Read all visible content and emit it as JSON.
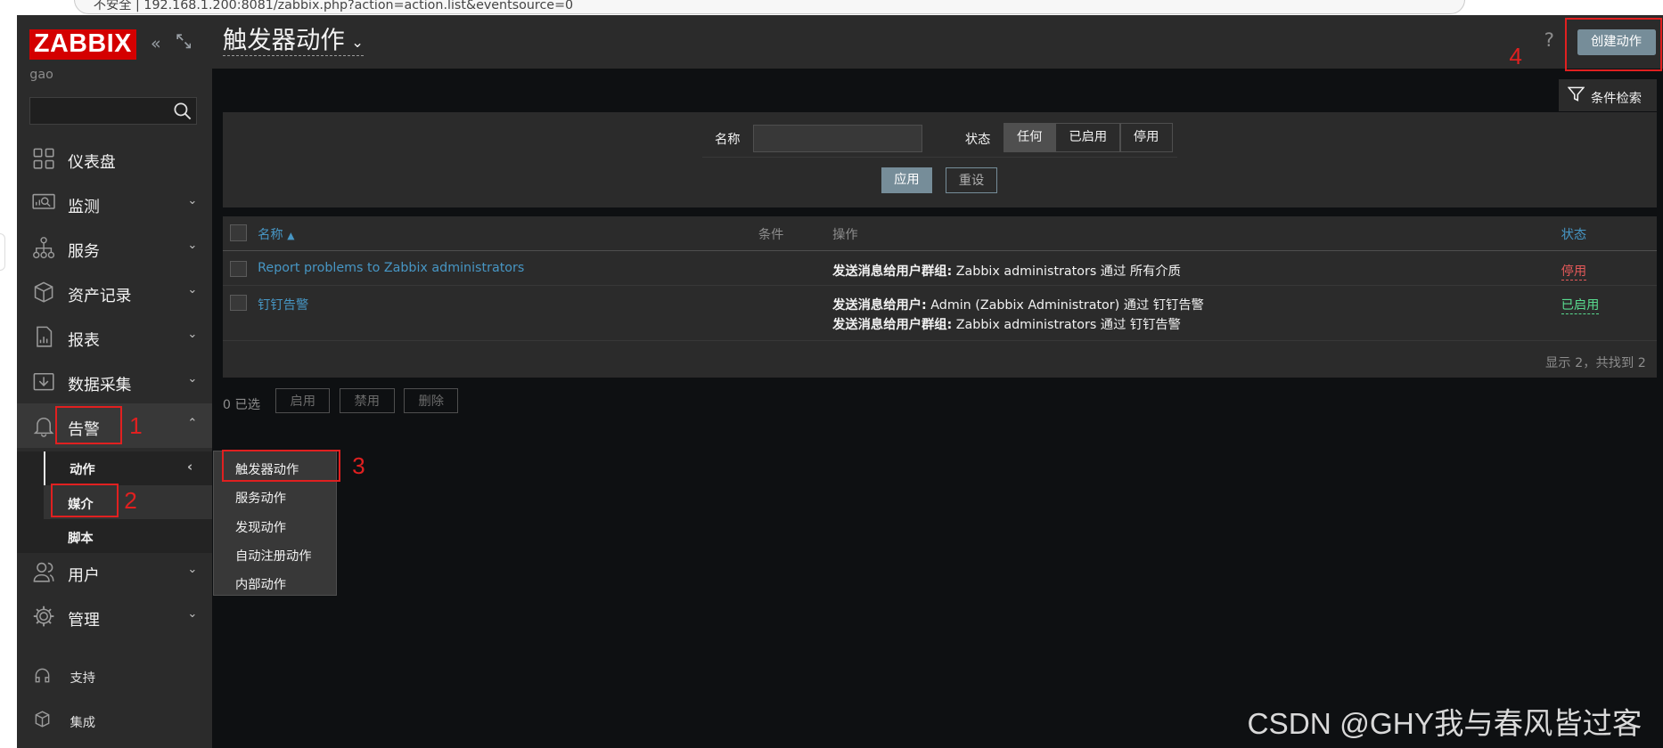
{
  "browser": {
    "url": "不安全 | 192.168.1.200:8081/zabbix.php?action=action.list&eventsource=0"
  },
  "sidebar": {
    "logo": "ZABBIX",
    "user": "gao",
    "nav": [
      {
        "label": "仪表盘",
        "icon": "dashboard-icon"
      },
      {
        "label": "监测",
        "icon": "monitoring-icon"
      },
      {
        "label": "服务",
        "icon": "services-icon"
      },
      {
        "label": "资产记录",
        "icon": "inventory-icon"
      },
      {
        "label": "报表",
        "icon": "reports-icon"
      },
      {
        "label": "数据采集",
        "icon": "data-collection-icon"
      },
      {
        "label": "告警",
        "icon": "bell-icon"
      },
      {
        "label": "用户",
        "icon": "users-icon"
      },
      {
        "label": "管理",
        "icon": "gear-icon"
      }
    ],
    "submenu": [
      "动作",
      "媒介",
      "脚本"
    ],
    "footer": [
      {
        "label": "支持",
        "icon": "headset-icon"
      },
      {
        "label": "集成",
        "icon": "box-icon"
      }
    ]
  },
  "header": {
    "title": "触发器动作",
    "help": "?",
    "create_button": "创建动作"
  },
  "filter": {
    "tab_label": "条件检索",
    "name_label": "名称",
    "name_value": "",
    "status_label": "状态",
    "status_options": [
      "任何",
      "已启用",
      "停用"
    ],
    "status_selected": "任何",
    "apply": "应用",
    "reset": "重设"
  },
  "table": {
    "columns": {
      "name": "名称",
      "sort_arrow": "▲",
      "conditions": "条件",
      "operations": "操作",
      "status": "状态"
    },
    "rows": [
      {
        "name": "Report problems to Zabbix administrators",
        "ops": [
          {
            "bold": "发送消息给用户群组:",
            "text": " Zabbix administrators 通过 所有介质"
          }
        ],
        "status": "停用"
      },
      {
        "name": "钉钉告警",
        "ops": [
          {
            "bold": "发送消息给用户:",
            "text": " Admin (Zabbix Administrator) 通过 钉钉告警"
          },
          {
            "bold": "发送消息给用户群组:",
            "text": " Zabbix administrators 通过 钉钉告警"
          }
        ],
        "status": "已启用"
      }
    ],
    "paging": "显示 2，共找到 2"
  },
  "bulk": {
    "selected": "0 已选",
    "buttons": [
      "启用",
      "禁用",
      "删除"
    ]
  },
  "popup_menu": [
    "触发器动作",
    "服务动作",
    "发现动作",
    "自动注册动作",
    "内部动作"
  ],
  "annotations": [
    "1",
    "2",
    "3",
    "4"
  ],
  "watermark": "CSDN @GHY我与春风皆过客",
  "colors": {
    "accent_link": "#4796c4",
    "button": "#768d99",
    "status_disabled": "#e45959",
    "status_enabled": "#59db8f",
    "annotation": "#e02020"
  }
}
